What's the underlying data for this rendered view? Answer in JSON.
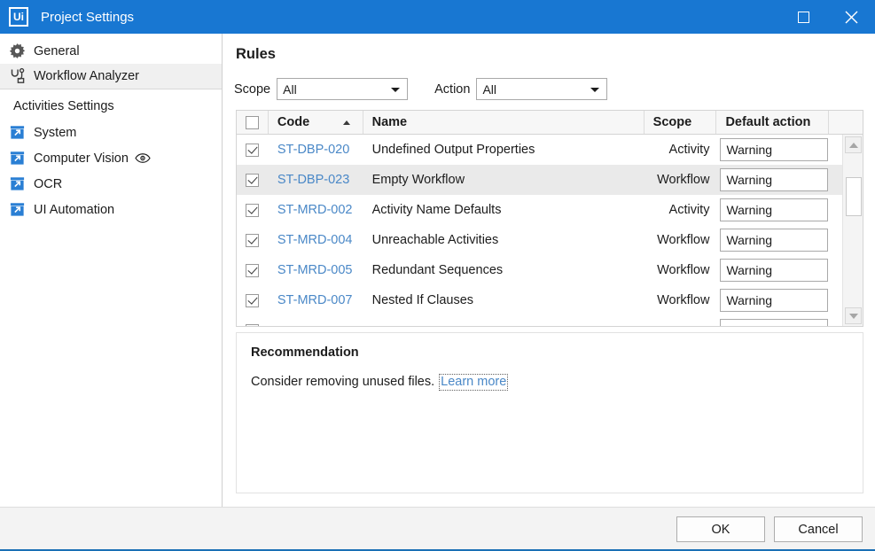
{
  "window": {
    "title": "Project Settings",
    "app_icon": "Ui",
    "icon_name": "uipath-logo-icon",
    "maximize_label": "",
    "close_label": "✕",
    "accent_color": "#1877d2",
    "link_color": "#4a88c7"
  },
  "sidebar": {
    "items": [
      {
        "label": "General",
        "icon": "gear-icon",
        "selected": false
      },
      {
        "label": "Workflow Analyzer",
        "icon": "stethoscope-icon",
        "selected": true
      }
    ],
    "section_label": "Activities Settings",
    "activity_items": [
      {
        "label": "System",
        "icon": "package-icon",
        "extra_icon": ""
      },
      {
        "label": "Computer Vision",
        "icon": "package-icon",
        "extra_icon": "eye-icon"
      },
      {
        "label": "OCR",
        "icon": "package-icon",
        "extra_icon": ""
      },
      {
        "label": "UI Automation",
        "icon": "package-icon",
        "extra_icon": ""
      }
    ]
  },
  "main": {
    "title": "Rules",
    "filters": {
      "scope_label": "Scope",
      "scope_value": "All",
      "action_label": "Action",
      "action_value": "All"
    },
    "table": {
      "headers": {
        "check": "",
        "code": "Code",
        "name": "Name",
        "scope": "Scope",
        "action": "Default action"
      },
      "select_all_checked": false,
      "sort_column": "Code",
      "sort_direction": "ascending",
      "rows": [
        {
          "checked": true,
          "code": "ST-DBP-020",
          "name": "Undefined Output Properties",
          "scope": "Activity",
          "action": "Warning",
          "selected": false
        },
        {
          "checked": true,
          "code": "ST-DBP-023",
          "name": "Empty Workflow",
          "scope": "Workflow",
          "action": "Warning",
          "selected": true
        },
        {
          "checked": true,
          "code": "ST-MRD-002",
          "name": "Activity Name Defaults",
          "scope": "Activity",
          "action": "Warning",
          "selected": false
        },
        {
          "checked": true,
          "code": "ST-MRD-004",
          "name": "Unreachable Activities",
          "scope": "Workflow",
          "action": "Warning",
          "selected": false
        },
        {
          "checked": true,
          "code": "ST-MRD-005",
          "name": "Redundant Sequences",
          "scope": "Workflow",
          "action": "Warning",
          "selected": false
        },
        {
          "checked": true,
          "code": "ST-MRD-007",
          "name": "Nested If Clauses",
          "scope": "Workflow",
          "action": "Warning",
          "selected": false
        },
        {
          "checked": true,
          "code": "",
          "name": "",
          "scope": "",
          "action": "",
          "selected": false
        }
      ]
    },
    "recommendation": {
      "title": "Recommendation",
      "text": "Consider removing unused files.",
      "link": "Learn more"
    }
  },
  "footer": {
    "ok_label": "OK",
    "cancel_label": "Cancel"
  }
}
